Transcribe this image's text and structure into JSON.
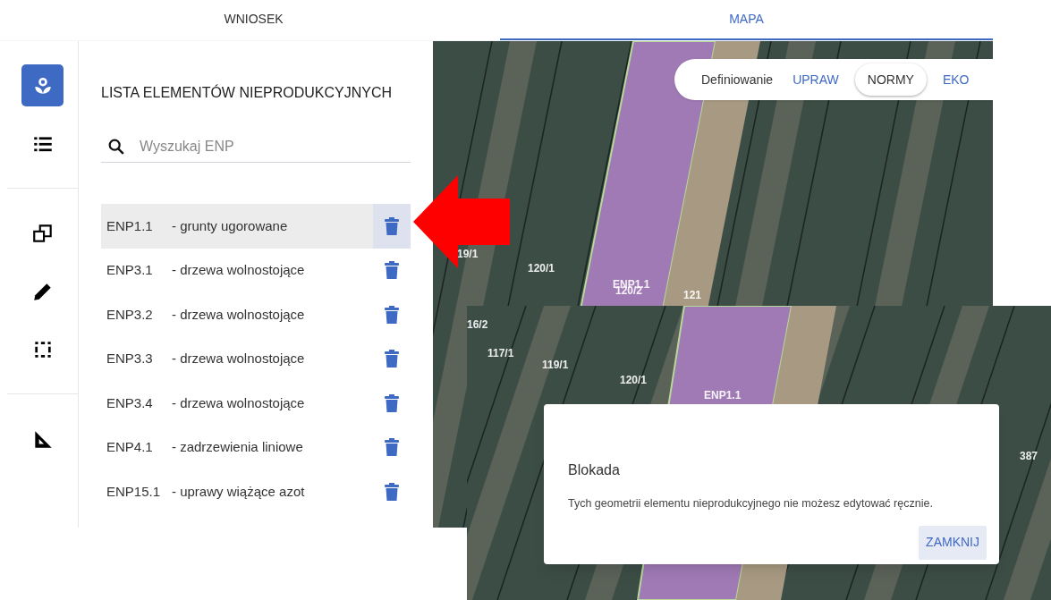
{
  "tabs": [
    {
      "label": "WNIOSEK",
      "selected": false
    },
    {
      "label": "MAPA",
      "selected": true
    }
  ],
  "tool_rail": {
    "groups": [
      [
        {
          "kind": "flower",
          "selected": true
        },
        {
          "kind": "list",
          "selected": false
        }
      ],
      [
        {
          "kind": "copy",
          "selected": false
        },
        {
          "kind": "pencil",
          "selected": false
        },
        {
          "kind": "select",
          "selected": false
        }
      ],
      [
        {
          "kind": "ruler",
          "selected": false
        }
      ]
    ]
  },
  "panel": {
    "title": "LISTA ELEMENTÓW NIEPRODUKCYJNYCH",
    "search": {
      "placeholder": "Wyszukaj ENP"
    },
    "items": [
      {
        "code": "ENP1.1",
        "name": "- grunty ugorowane",
        "selected": true
      },
      {
        "code": "ENP3.1",
        "name": "- drzewa wolnostojące",
        "selected": false
      },
      {
        "code": "ENP3.2",
        "name": "- drzewa wolnostojące",
        "selected": false
      },
      {
        "code": "ENP3.3",
        "name": "- drzewa wolnostojące",
        "selected": false
      },
      {
        "code": "ENP3.4",
        "name": "- drzewa wolnostojące",
        "selected": false
      },
      {
        "code": "ENP4.1",
        "name": "- zadrzewienia liniowe",
        "selected": false
      },
      {
        "code": "ENP15.1",
        "name": "- uprawy wiążące azot",
        "selected": false
      }
    ]
  },
  "map": {
    "mode_switch": {
      "label": "Definiowanie",
      "options": [
        {
          "label": "UPRAW",
          "selected": false
        },
        {
          "label": "NORMY",
          "selected": true
        },
        {
          "label": "EKO",
          "selected": false
        }
      ]
    },
    "labels": [
      "19/1",
      "120/1",
      "ENP1.1",
      "120/2",
      "121"
    ]
  },
  "inset": {
    "labels": [
      "16/2",
      "117/1",
      "119/1",
      "120/1",
      "ENP1.1",
      "387"
    ],
    "dialog": {
      "title": "Blokada",
      "message": "Tych geometrii elementu nieprodukcyjnego nie możesz edytować ręcznie.",
      "button": "ZAMKNIJ"
    }
  }
}
